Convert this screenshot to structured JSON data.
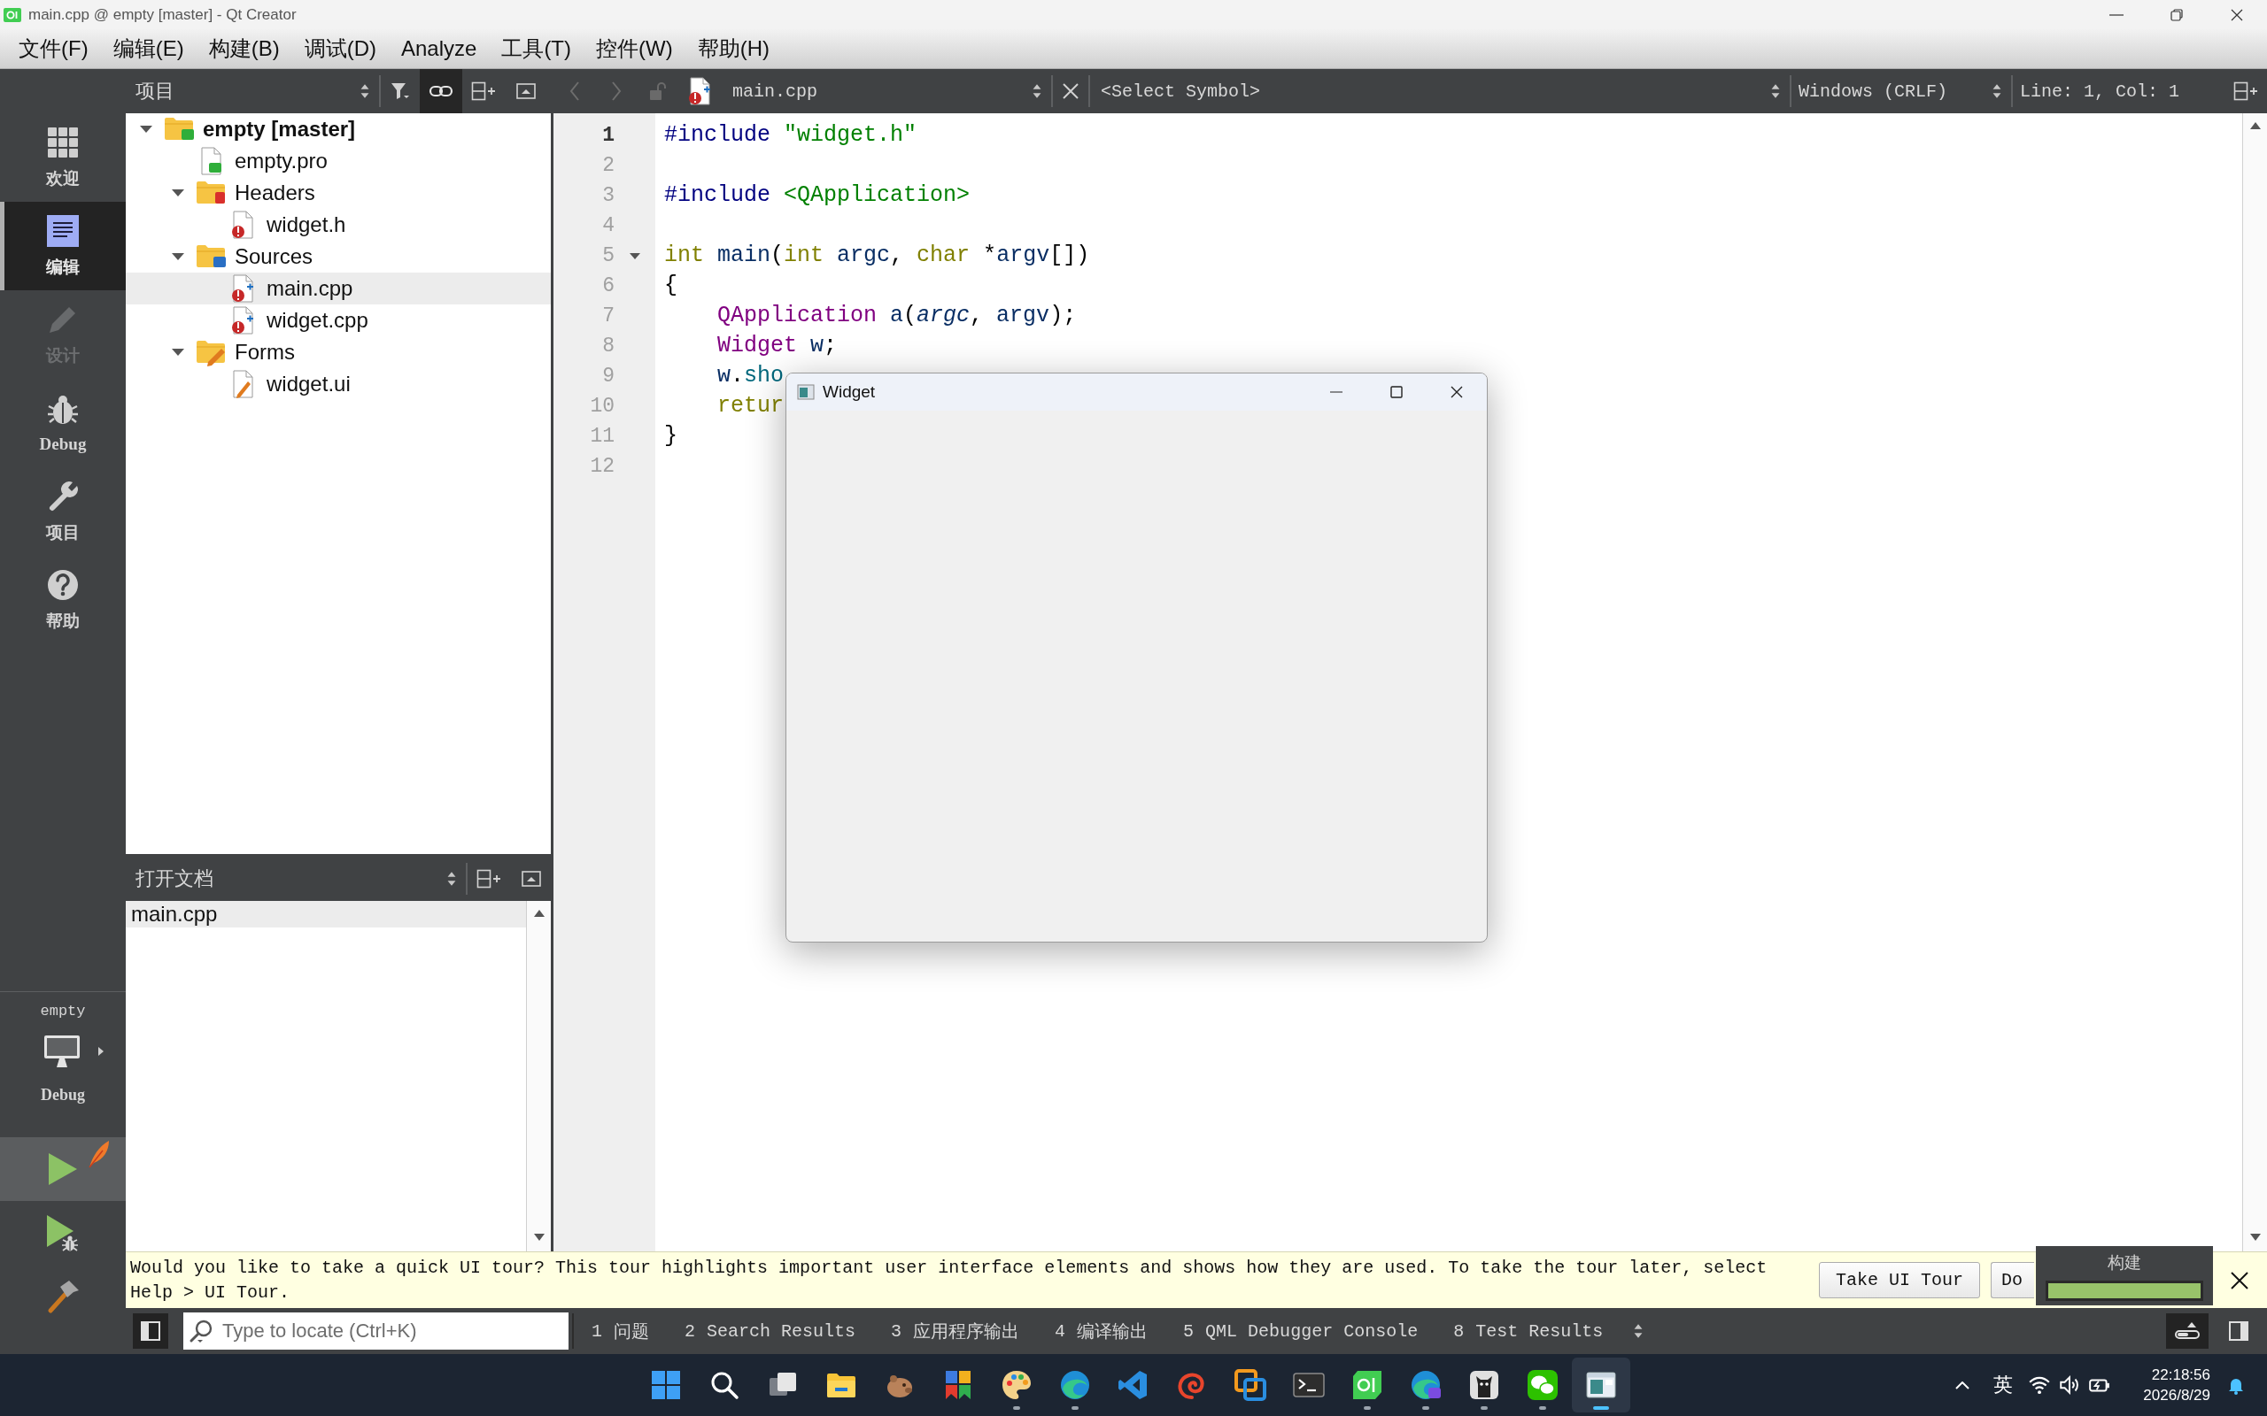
{
  "window": {
    "title": "main.cpp @ empty [master] - Qt Creator"
  },
  "menu": [
    "文件(F)",
    "编辑(E)",
    "构建(B)",
    "调试(D)",
    "Analyze",
    "工具(T)",
    "控件(W)",
    "帮助(H)"
  ],
  "mode_bar": {
    "modes": [
      {
        "kind": "welcome",
        "label": "欢迎",
        "selected": false,
        "disabled": false
      },
      {
        "kind": "edit",
        "label": "编辑",
        "selected": true,
        "disabled": false
      },
      {
        "kind": "design",
        "label": "设计",
        "selected": false,
        "disabled": true
      },
      {
        "kind": "debug",
        "label": "Debug",
        "selected": false,
        "disabled": false
      },
      {
        "kind": "projects",
        "label": "项目",
        "selected": false,
        "disabled": false
      },
      {
        "kind": "help",
        "label": "帮助",
        "selected": false,
        "disabled": false
      }
    ],
    "target": {
      "project": "empty",
      "build": "Debug"
    },
    "actions": [
      {
        "kind": "run",
        "highlighted": true
      },
      {
        "kind": "debug_run",
        "highlighted": false
      },
      {
        "kind": "build",
        "highlighted": false
      }
    ]
  },
  "project_panel": {
    "title": "项目",
    "tools": [
      {
        "kind": "filter",
        "checked": false
      },
      {
        "kind": "link",
        "checked": true
      },
      {
        "kind": "split",
        "checked": false
      },
      {
        "kind": "collapse",
        "checked": false
      }
    ],
    "tree": [
      {
        "label": "empty [master]",
        "kind": "project",
        "expanded": true,
        "selected": false,
        "error": false,
        "children": [
          {
            "label": "empty.pro",
            "kind": "pro_file",
            "selected": false,
            "error": false
          },
          {
            "label": "Headers",
            "kind": "header_folder",
            "expanded": true,
            "selected": false,
            "error": false,
            "children": [
              {
                "label": "widget.h",
                "kind": "header",
                "selected": false,
                "error": true
              }
            ]
          },
          {
            "label": "Sources",
            "kind": "source_folder",
            "expanded": true,
            "selected": false,
            "error": false,
            "children": [
              {
                "label": "main.cpp",
                "kind": "source",
                "selected": true,
                "error": true
              },
              {
                "label": "widget.cpp",
                "kind": "source",
                "selected": false,
                "error": true
              }
            ]
          },
          {
            "label": "Forms",
            "kind": "form_folder",
            "expanded": true,
            "selected": false,
            "error": false,
            "children": [
              {
                "label": "widget.ui",
                "kind": "form",
                "selected": false,
                "error": false
              }
            ]
          }
        ]
      }
    ]
  },
  "open_documents": {
    "title": "打开文档",
    "tools": [
      {
        "kind": "split",
        "checked": false
      },
      {
        "kind": "collapse",
        "checked": false
      }
    ],
    "items": [
      {
        "label": "main.cpp",
        "selected": true
      }
    ]
  },
  "editor": {
    "toolbar": {
      "back": {
        "disabled": true
      },
      "forward": {
        "disabled": true
      },
      "file": "main.cpp",
      "file_error": true,
      "symbol": "<Select Symbol>",
      "line_ending": "Windows (CRLF)",
      "position": "Line: 1, Col: 1"
    },
    "lines": [
      {
        "number": "1",
        "current": true,
        "fold": false,
        "tokens": [
          {
            "text": "#include ",
            "kind": "preprocessor"
          },
          {
            "text": "\"widget.h\"",
            "kind": "string"
          }
        ]
      },
      {
        "number": "2",
        "current": false,
        "fold": false
      },
      {
        "number": "3",
        "current": false,
        "fold": false,
        "tokens": [
          {
            "text": "#include ",
            "kind": "preprocessor"
          },
          {
            "text": "<QApplication>",
            "kind": "string"
          }
        ]
      },
      {
        "number": "4",
        "current": false,
        "fold": false
      },
      {
        "number": "5",
        "current": false,
        "fold": true,
        "tokens": [
          {
            "text": "int",
            "kind": "keyword"
          },
          {
            "text": " main",
            "kind": "name"
          },
          {
            "text": "(",
            "kind": "plain"
          },
          {
            "text": "int",
            "kind": "keyword"
          },
          {
            "text": " argc",
            "kind": "name"
          },
          {
            "text": ", ",
            "kind": "plain"
          },
          {
            "text": "char",
            "kind": "keyword"
          },
          {
            "text": " *",
            "kind": "plain"
          },
          {
            "text": "argv",
            "kind": "name"
          },
          {
            "text": "[])",
            "kind": "plain"
          }
        ]
      },
      {
        "number": "6",
        "current": false,
        "fold": false,
        "tokens": [
          {
            "text": "{",
            "kind": "plain"
          }
        ]
      },
      {
        "number": "7",
        "current": false,
        "fold": false,
        "tokens": [
          {
            "text": "    QApplication",
            "kind": "type"
          },
          {
            "text": " a",
            "kind": "name"
          },
          {
            "text": "(",
            "kind": "plain"
          },
          {
            "text": "argc",
            "kind": "param"
          },
          {
            "text": ", ",
            "kind": "plain"
          },
          {
            "text": "argv",
            "kind": "name"
          },
          {
            "text": ");",
            "kind": "plain"
          }
        ]
      },
      {
        "number": "8",
        "current": false,
        "fold": false,
        "tokens": [
          {
            "text": "    Widget",
            "kind": "type"
          },
          {
            "text": " w",
            "kind": "name"
          },
          {
            "text": ";",
            "kind": "plain"
          }
        ]
      },
      {
        "number": "9",
        "current": false,
        "fold": false,
        "tokens": [
          {
            "text": "    w",
            "kind": "name"
          },
          {
            "text": ".",
            "kind": "plain"
          },
          {
            "text": "sho",
            "kind": "function"
          }
        ]
      },
      {
        "number": "10",
        "current": false,
        "fold": false,
        "tokens": [
          {
            "text": "    retur",
            "kind": "keyword"
          }
        ]
      },
      {
        "number": "11",
        "current": false,
        "fold": false,
        "tokens": [
          {
            "text": "}",
            "kind": "plain"
          }
        ]
      },
      {
        "number": "12",
        "current": false,
        "fold": false
      }
    ]
  },
  "app_window": {
    "title": "Widget"
  },
  "tour": {
    "text": "Would you like to take a quick UI tour? This tour highlights important user interface elements and shows how they are used. To take the tour later, select Help > UI Tour.",
    "buttons": [
      "Take UI Tour",
      "Do"
    ]
  },
  "build_progress": {
    "title": "构建",
    "level": 1
  },
  "output_bar": {
    "left_sidebar": {
      "checked": true
    },
    "locator": {
      "placeholder": "Type to locate (Ctrl+K)"
    },
    "tabs": [
      {
        "number": "1",
        "label": "问题"
      },
      {
        "number": "2",
        "label": "Search Results"
      },
      {
        "number": "3",
        "label": "应用程序输出"
      },
      {
        "number": "4",
        "label": "编译输出"
      },
      {
        "number": "5",
        "label": "QML Debugger Console"
      },
      {
        "number": "8",
        "label": "Test Results"
      }
    ],
    "progress_toggle": {
      "checked": true
    }
  },
  "taskbar": {
    "apps": [
      {
        "kind": "start",
        "running": false,
        "selected": false
      },
      {
        "kind": "search",
        "running": false,
        "selected": false
      },
      {
        "kind": "task_view",
        "running": false,
        "selected": false
      },
      {
        "kind": "files",
        "running": false,
        "selected": false
      },
      {
        "kind": "animal",
        "running": false,
        "selected": false
      },
      {
        "kind": "blocks",
        "running": false,
        "selected": false
      },
      {
        "kind": "palette",
        "running": true,
        "selected": false
      },
      {
        "kind": "browser",
        "running": true,
        "selected": false
      },
      {
        "kind": "code",
        "running": false,
        "selected": false
      },
      {
        "kind": "spiral",
        "running": false,
        "selected": false
      },
      {
        "kind": "squares",
        "running": false,
        "selected": false
      },
      {
        "kind": "terminal",
        "running": false,
        "selected": false
      },
      {
        "kind": "qt",
        "running": true,
        "selected": false
      },
      {
        "kind": "browser_ai",
        "running": true,
        "selected": false
      },
      {
        "kind": "cat",
        "running": true,
        "selected": false
      },
      {
        "kind": "chat",
        "running": true,
        "selected": false
      },
      {
        "kind": "widget_app",
        "running": true,
        "selected": true
      }
    ],
    "tray": {
      "input_method": "英",
      "time": "22:18:56",
      "date": "2026/8/29"
    }
  }
}
